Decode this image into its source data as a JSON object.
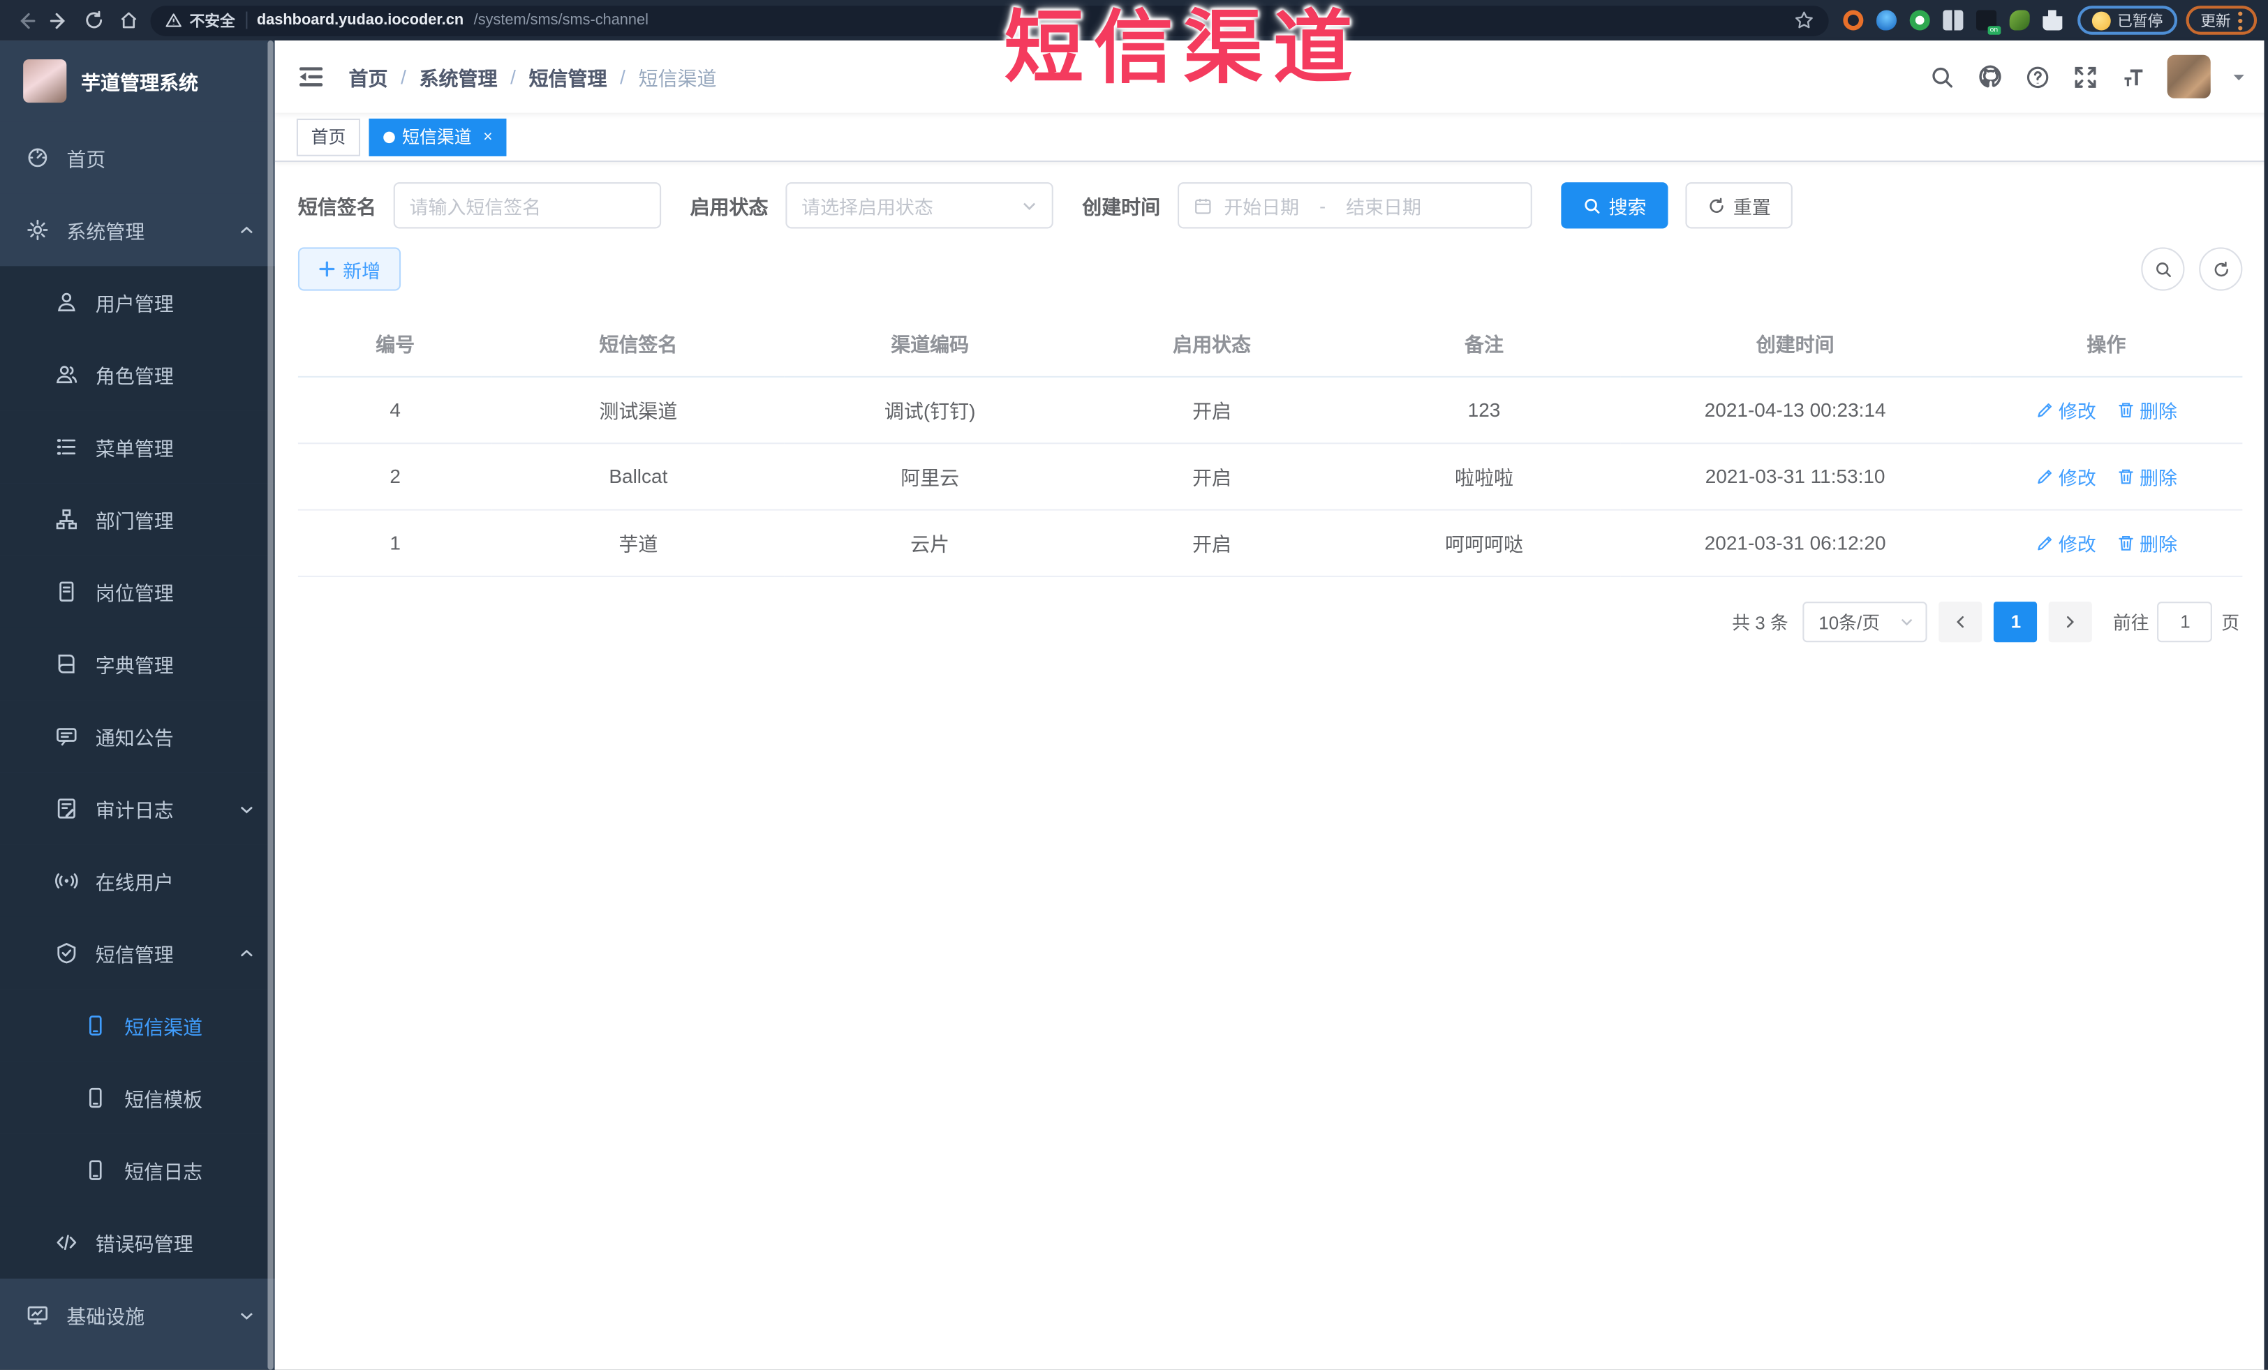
{
  "browser": {
    "security_label": "不安全",
    "url_host": "dashboard.yudao.iocoder.cn",
    "url_path": "/system/sms/sms-channel",
    "extensions": [
      {
        "icon": "bookmark-star-icon"
      },
      {
        "icon": "ext-orange-ring-icon"
      },
      {
        "icon": "ext-blue-drop-icon"
      },
      {
        "icon": "ext-green-check-icon"
      },
      {
        "icon": "ext-grid-blue-dot-icon"
      },
      {
        "icon": "ext-dark-on-badge-icon"
      },
      {
        "icon": "ext-green-leaf-icon"
      },
      {
        "icon": "ext-puzzle-icon"
      }
    ],
    "profile_chip_label": "已暂停",
    "update_chip_label": "更新"
  },
  "overlay": {
    "title": "短信渠道",
    "color": "#f43b5e"
  },
  "sidebar": {
    "logo_title": "芋道管理系统",
    "menu": [
      {
        "label": "首页",
        "icon": "dashboard-icon",
        "level": 1
      },
      {
        "label": "系统管理",
        "icon": "gear-icon",
        "level": 1,
        "chevron": "up"
      },
      {
        "label": "用户管理",
        "icon": "user-icon",
        "level": 2
      },
      {
        "label": "角色管理",
        "icon": "role-icon",
        "level": 2
      },
      {
        "label": "菜单管理",
        "icon": "menu-list-icon",
        "level": 2
      },
      {
        "label": "部门管理",
        "icon": "org-tree-icon",
        "level": 2
      },
      {
        "label": "岗位管理",
        "icon": "post-badge-icon",
        "level": 2
      },
      {
        "label": "字典管理",
        "icon": "dict-book-icon",
        "level": 2
      },
      {
        "label": "通知公告",
        "icon": "notice-icon",
        "level": 2
      },
      {
        "label": "审计日志",
        "icon": "audit-log-icon",
        "level": 2,
        "chevron": "down"
      },
      {
        "label": "在线用户",
        "icon": "online-user-icon",
        "level": 2
      },
      {
        "label": "短信管理",
        "icon": "sms-shield-icon",
        "level": 2,
        "chevron": "up"
      },
      {
        "label": "短信渠道",
        "icon": "phone-icon",
        "level": 3,
        "active": true
      },
      {
        "label": "短信模板",
        "icon": "phone-icon",
        "level": 3
      },
      {
        "label": "短信日志",
        "icon": "phone-icon",
        "level": 3
      },
      {
        "label": "错误码管理",
        "icon": "code-icon",
        "level": 2
      },
      {
        "label": "基础设施",
        "icon": "infra-monitor-icon",
        "level": 1,
        "chevron": "down"
      }
    ]
  },
  "header": {
    "breadcrumb": [
      "首页",
      "系统管理",
      "短信管理",
      "短信渠道"
    ]
  },
  "tabs": [
    {
      "label": "首页",
      "active": false,
      "closable": false
    },
    {
      "label": "短信渠道",
      "active": true,
      "closable": true
    }
  ],
  "filters": {
    "sign_label": "短信签名",
    "sign_placeholder": "请输入短信签名",
    "status_label": "启用状态",
    "status_placeholder": "请选择启用状态",
    "time_label": "创建时间",
    "start_placeholder": "开始日期",
    "range_separator": "-",
    "end_placeholder": "结束日期",
    "search_label": "搜索",
    "reset_label": "重置"
  },
  "toolbar": {
    "add_label": "新增"
  },
  "table": {
    "columns": [
      "编号",
      "短信签名",
      "渠道编码",
      "启用状态",
      "备注",
      "创建时间",
      "操作"
    ],
    "edit_label": "修改",
    "delete_label": "删除",
    "rows": [
      {
        "id": "4",
        "sign": "测试渠道",
        "code": "调试(钉钉)",
        "status": "开启",
        "remark": "123",
        "created": "2021-04-13 00:23:14"
      },
      {
        "id": "2",
        "sign": "Ballcat",
        "code": "阿里云",
        "status": "开启",
        "remark": "啦啦啦",
        "created": "2021-03-31 11:53:10"
      },
      {
        "id": "1",
        "sign": "芋道",
        "code": "云片",
        "status": "开启",
        "remark": "呵呵呵哒",
        "created": "2021-03-31 06:12:20"
      }
    ]
  },
  "pagination": {
    "total_label": "共 3 条",
    "page_size_label": "10条/页",
    "current_page": "1",
    "goto_label": "前往",
    "goto_value": "1",
    "page_unit_label": "页"
  }
}
